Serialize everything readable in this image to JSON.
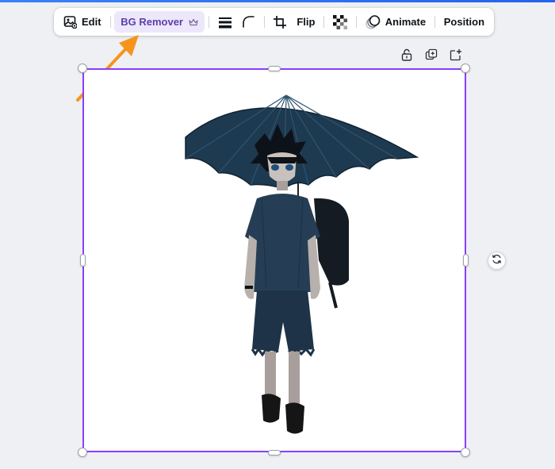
{
  "toolbar": {
    "edit_label": "Edit",
    "bg_remover_label": "BG Remover",
    "flip_label": "Flip",
    "animate_label": "Animate",
    "position_label": "Position"
  },
  "icons": {
    "edit": "edit-image-icon",
    "crown": "crown-icon",
    "border_style": "border-style-icon",
    "corner_rounding": "corner-rounding-icon",
    "crop": "crop-icon",
    "transparency": "transparency-icon",
    "animate": "animate-icon",
    "lock": "lock-icon",
    "duplicate": "duplicate-icon",
    "add_page": "add-icon",
    "rotate": "rotate-icon"
  },
  "colors": {
    "selection": "#8b3dff",
    "bg_remover_bg": "#ede7fc",
    "bg_remover_text": "#5b3ea8",
    "arrow": "#f7941d",
    "accent_strip": "#3b82f6"
  }
}
